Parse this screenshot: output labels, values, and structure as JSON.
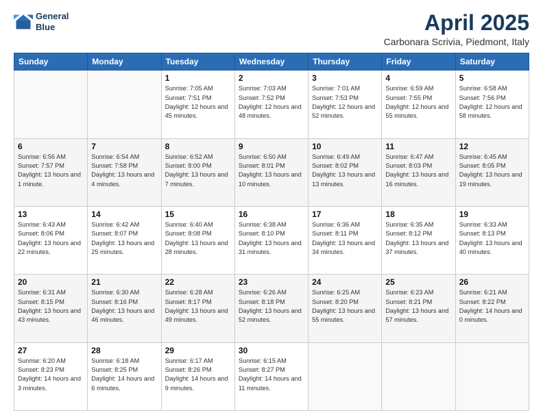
{
  "header": {
    "logo_line1": "General",
    "logo_line2": "Blue",
    "title": "April 2025",
    "subtitle": "Carbonara Scrivia, Piedmont, Italy"
  },
  "columns": [
    "Sunday",
    "Monday",
    "Tuesday",
    "Wednesday",
    "Thursday",
    "Friday",
    "Saturday"
  ],
  "weeks": [
    [
      {
        "day": "",
        "info": ""
      },
      {
        "day": "",
        "info": ""
      },
      {
        "day": "1",
        "info": "Sunrise: 7:05 AM\nSunset: 7:51 PM\nDaylight: 12 hours and 45 minutes."
      },
      {
        "day": "2",
        "info": "Sunrise: 7:03 AM\nSunset: 7:52 PM\nDaylight: 12 hours and 48 minutes."
      },
      {
        "day": "3",
        "info": "Sunrise: 7:01 AM\nSunset: 7:53 PM\nDaylight: 12 hours and 52 minutes."
      },
      {
        "day": "4",
        "info": "Sunrise: 6:59 AM\nSunset: 7:55 PM\nDaylight: 12 hours and 55 minutes."
      },
      {
        "day": "5",
        "info": "Sunrise: 6:58 AM\nSunset: 7:56 PM\nDaylight: 12 hours and 58 minutes."
      }
    ],
    [
      {
        "day": "6",
        "info": "Sunrise: 6:56 AM\nSunset: 7:57 PM\nDaylight: 13 hours and 1 minute."
      },
      {
        "day": "7",
        "info": "Sunrise: 6:54 AM\nSunset: 7:58 PM\nDaylight: 13 hours and 4 minutes."
      },
      {
        "day": "8",
        "info": "Sunrise: 6:52 AM\nSunset: 8:00 PM\nDaylight: 13 hours and 7 minutes."
      },
      {
        "day": "9",
        "info": "Sunrise: 6:50 AM\nSunset: 8:01 PM\nDaylight: 13 hours and 10 minutes."
      },
      {
        "day": "10",
        "info": "Sunrise: 6:49 AM\nSunset: 8:02 PM\nDaylight: 13 hours and 13 minutes."
      },
      {
        "day": "11",
        "info": "Sunrise: 6:47 AM\nSunset: 8:03 PM\nDaylight: 13 hours and 16 minutes."
      },
      {
        "day": "12",
        "info": "Sunrise: 6:45 AM\nSunset: 8:05 PM\nDaylight: 13 hours and 19 minutes."
      }
    ],
    [
      {
        "day": "13",
        "info": "Sunrise: 6:43 AM\nSunset: 8:06 PM\nDaylight: 13 hours and 22 minutes."
      },
      {
        "day": "14",
        "info": "Sunrise: 6:42 AM\nSunset: 8:07 PM\nDaylight: 13 hours and 25 minutes."
      },
      {
        "day": "15",
        "info": "Sunrise: 6:40 AM\nSunset: 8:08 PM\nDaylight: 13 hours and 28 minutes."
      },
      {
        "day": "16",
        "info": "Sunrise: 6:38 AM\nSunset: 8:10 PM\nDaylight: 13 hours and 31 minutes."
      },
      {
        "day": "17",
        "info": "Sunrise: 6:36 AM\nSunset: 8:11 PM\nDaylight: 13 hours and 34 minutes."
      },
      {
        "day": "18",
        "info": "Sunrise: 6:35 AM\nSunset: 8:12 PM\nDaylight: 13 hours and 37 minutes."
      },
      {
        "day": "19",
        "info": "Sunrise: 6:33 AM\nSunset: 8:13 PM\nDaylight: 13 hours and 40 minutes."
      }
    ],
    [
      {
        "day": "20",
        "info": "Sunrise: 6:31 AM\nSunset: 8:15 PM\nDaylight: 13 hours and 43 minutes."
      },
      {
        "day": "21",
        "info": "Sunrise: 6:30 AM\nSunset: 8:16 PM\nDaylight: 13 hours and 46 minutes."
      },
      {
        "day": "22",
        "info": "Sunrise: 6:28 AM\nSunset: 8:17 PM\nDaylight: 13 hours and 49 minutes."
      },
      {
        "day": "23",
        "info": "Sunrise: 6:26 AM\nSunset: 8:18 PM\nDaylight: 13 hours and 52 minutes."
      },
      {
        "day": "24",
        "info": "Sunrise: 6:25 AM\nSunset: 8:20 PM\nDaylight: 13 hours and 55 minutes."
      },
      {
        "day": "25",
        "info": "Sunrise: 6:23 AM\nSunset: 8:21 PM\nDaylight: 13 hours and 57 minutes."
      },
      {
        "day": "26",
        "info": "Sunrise: 6:21 AM\nSunset: 8:22 PM\nDaylight: 14 hours and 0 minutes."
      }
    ],
    [
      {
        "day": "27",
        "info": "Sunrise: 6:20 AM\nSunset: 8:23 PM\nDaylight: 14 hours and 3 minutes."
      },
      {
        "day": "28",
        "info": "Sunrise: 6:18 AM\nSunset: 8:25 PM\nDaylight: 14 hours and 6 minutes."
      },
      {
        "day": "29",
        "info": "Sunrise: 6:17 AM\nSunset: 8:26 PM\nDaylight: 14 hours and 9 minutes."
      },
      {
        "day": "30",
        "info": "Sunrise: 6:15 AM\nSunset: 8:27 PM\nDaylight: 14 hours and 11 minutes."
      },
      {
        "day": "",
        "info": ""
      },
      {
        "day": "",
        "info": ""
      },
      {
        "day": "",
        "info": ""
      }
    ]
  ]
}
